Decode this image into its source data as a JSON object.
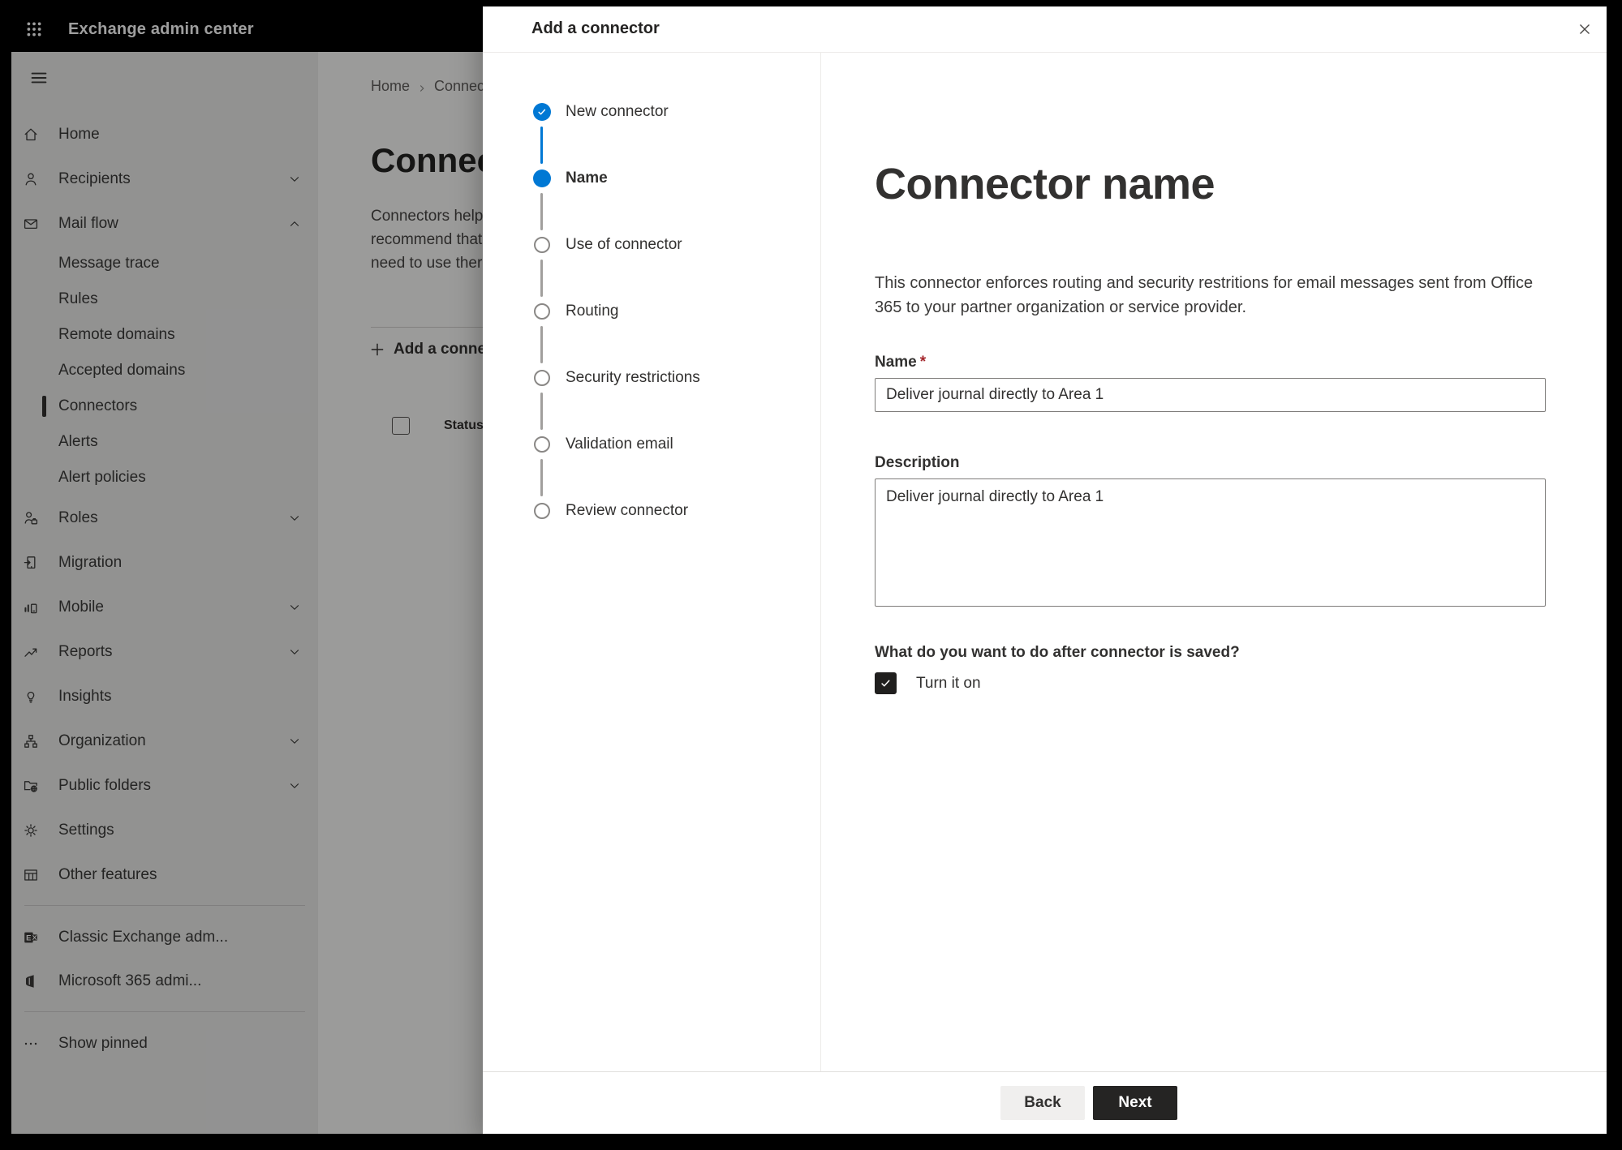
{
  "app": {
    "topbar_title": "Exchange admin center"
  },
  "sidebar": {
    "items": [
      {
        "label": "Home"
      },
      {
        "label": "Recipients"
      },
      {
        "label": "Mail flow"
      },
      {
        "label": "Message trace"
      },
      {
        "label": "Rules"
      },
      {
        "label": "Remote domains"
      },
      {
        "label": "Accepted domains"
      },
      {
        "label": "Connectors"
      },
      {
        "label": "Alerts"
      },
      {
        "label": "Alert policies"
      },
      {
        "label": "Roles"
      },
      {
        "label": "Migration"
      },
      {
        "label": "Mobile"
      },
      {
        "label": "Reports"
      },
      {
        "label": "Insights"
      },
      {
        "label": "Organization"
      },
      {
        "label": "Public folders"
      },
      {
        "label": "Settings"
      },
      {
        "label": "Other features"
      },
      {
        "label": "Classic Exchange adm..."
      },
      {
        "label": "Microsoft 365 admi..."
      },
      {
        "label": "Show pinned"
      }
    ]
  },
  "page": {
    "breadcrumb": {
      "home": "Home",
      "current": "Connectors"
    },
    "title": "Connectors",
    "intro_lines": {
      "l1": "Connectors help",
      "l2": "recommend that",
      "l3": "need to use ther"
    },
    "add_button": "Add a connector",
    "table": {
      "status_header": "Status"
    }
  },
  "dialog": {
    "title": "Add a connector",
    "steps": [
      {
        "label": "New connector",
        "state": "completed"
      },
      {
        "label": "Name",
        "state": "current"
      },
      {
        "label": "Use of connector",
        "state": "upcoming"
      },
      {
        "label": "Routing",
        "state": "upcoming"
      },
      {
        "label": "Security restrictions",
        "state": "upcoming"
      },
      {
        "label": "Validation email",
        "state": "upcoming"
      },
      {
        "label": "Review connector",
        "state": "upcoming"
      }
    ],
    "content": {
      "heading": "Connector name",
      "description": "This connector enforces routing and security restritions for email messages sent from Office 365 to your partner organization or service provider.",
      "name_label": "Name",
      "required_mark": "*",
      "name_value": "Deliver journal directly to Area 1",
      "description_label": "Description",
      "description_value": "Deliver journal directly to Area 1",
      "after_save_question": "What do you want to do after connector is saved?",
      "turn_on_label": "Turn it on"
    },
    "footer": {
      "back_label": "Back",
      "next_label": "Next"
    }
  },
  "colors": {
    "accent": "#0078d4",
    "topbar": "#000000",
    "overlay": "rgba(0,0,0,0.38)",
    "next_button": "#252423",
    "required_mark": "#a4262c",
    "selected_indicator": "#323130"
  }
}
